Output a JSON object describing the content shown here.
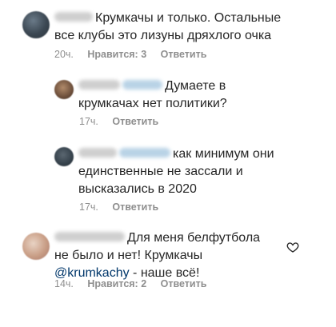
{
  "comments": [
    {
      "text": "Крумкачы и только. Остальные все клубы это лизуны дряхлого очка",
      "time": "20ч.",
      "likes": "Нравится: 3",
      "reply": "Ответить"
    },
    {
      "text": "Думаете в крумкачах нет политики?",
      "time": "17ч.",
      "reply": "Ответить"
    },
    {
      "text": "как минимум они единственные не зассали и высказались в 2020",
      "time": "17ч.",
      "reply": "Ответить"
    },
    {
      "text_before": "Для меня белфутбола не было и нет! Крумкачы ",
      "mention": "@krumkachy",
      "text_after": " - наше всё!",
      "time": "14ч.",
      "likes": "Нравится: 2",
      "reply": "Ответить"
    }
  ],
  "icons": {
    "heart": "heart-outline-icon"
  },
  "colors": {
    "mention": "#00376b",
    "meta": "#8e8e8e"
  }
}
